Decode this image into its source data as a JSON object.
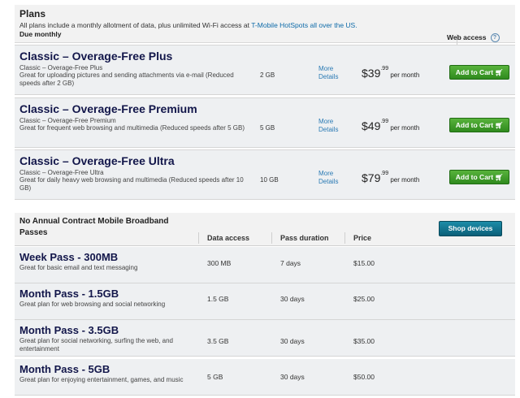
{
  "plans_section": {
    "title": "Plans",
    "description_prefix": "All plans include a monthly allotment of data, plus unlimited Wi-Fi access at ",
    "description_link": "T-Mobile HotSpots all over the US.",
    "due_monthly": "Due monthly",
    "web_access_label": "Web access",
    "help_icon": "?"
  },
  "plans": [
    {
      "name": "Classic – Overage-Free Plus",
      "subtitle": "Classic – Overage-Free Plus",
      "description": "Great for uploading pictures and sending attachments via e-mail (Reduced speeds after 2 GB)",
      "data": "2 GB",
      "more_details": "More Details",
      "price_dollars": "$39",
      "price_cents": ".99",
      "per": " per month",
      "button": "Add to Cart"
    },
    {
      "name": "Classic – Overage-Free Premium",
      "subtitle": "Classic – Overage-Free Premium",
      "description": "Great for frequent web browsing and multimedia (Reduced speeds after 5 GB)",
      "data": "5 GB",
      "more_details": "More Details",
      "price_dollars": "$49",
      "price_cents": ".99",
      "per": " per month",
      "button": "Add to Cart"
    },
    {
      "name": "Classic – Overage-Free Ultra",
      "subtitle": "Classic – Overage-Free Ultra",
      "description": "Great for daily heavy web browsing and multimedia (Reduced speeds after 10 GB)",
      "data": "10 GB",
      "more_details": "More Details",
      "price_dollars": "$79",
      "price_cents": ".99",
      "per": " per month",
      "button": "Add to Cart"
    }
  ],
  "broadband": {
    "title": "No Annual Contract Mobile Broadband Passes",
    "col_data": "Data access",
    "col_duration": "Pass duration",
    "col_price": "Price",
    "shop_button": "Shop devices"
  },
  "passes": [
    {
      "name": "Week Pass - 300MB",
      "description": "Great for basic email and text messaging",
      "data": "300 MB",
      "duration": "7 days",
      "price": "$15.00"
    },
    {
      "name": "Month Pass - 1.5GB",
      "description": "Great plan for web browsing and social networking",
      "data": "1.5 GB",
      "duration": "30 days",
      "price": "$25.00"
    },
    {
      "name": "Month Pass - 3.5GB",
      "description": "Great plan for social networking, surfing the web, and entertainment",
      "data": "3.5 GB",
      "duration": "30 days",
      "price": "$35.00"
    },
    {
      "name": "Month Pass - 5GB",
      "description": "Great plan for enjoying entertainment, games, and music",
      "data": "5 GB",
      "duration": "30 days",
      "price": "$50.00"
    }
  ],
  "icons": {
    "cart": "cart-icon",
    "help": "help-icon"
  },
  "colors": {
    "add_to_cart": "#3f9e2a",
    "shop_devices": "#137a94",
    "plan_title": "#12164a",
    "link": "#2a7ab4"
  }
}
